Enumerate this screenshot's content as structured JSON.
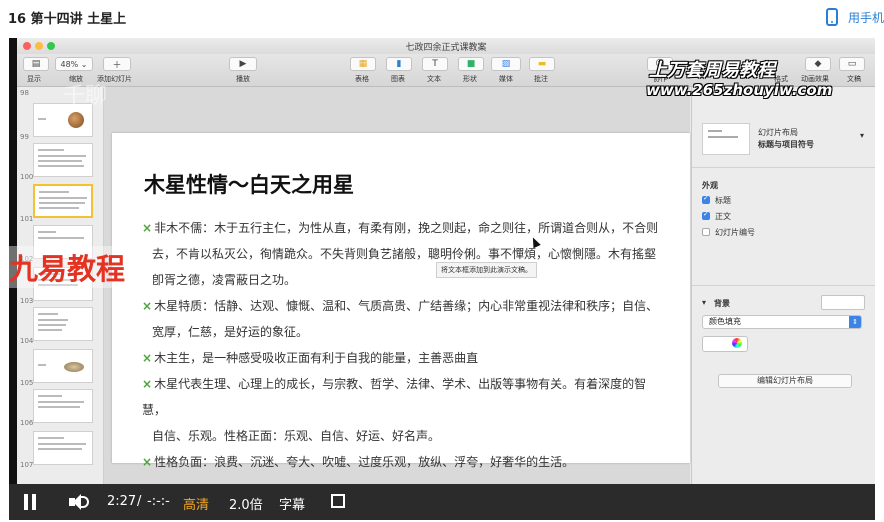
{
  "page": {
    "title": "16 第十四讲 土星上",
    "phone_label": "用手机"
  },
  "window": {
    "doc_title": "七政四余正式课教案"
  },
  "toolbar": {
    "view_label": "显示",
    "zoom_value": "48%",
    "zoom_label": "缩放",
    "add_slide_label": "添加幻灯片",
    "play_label": "播放",
    "table_label": "表格",
    "chart_label": "图表",
    "text_label": "文本",
    "shape_label": "形状",
    "media_label": "媒体",
    "comment_label": "批注",
    "collaborate_label": "协作",
    "format_label": "格式",
    "animate_label": "动画效果",
    "document_label": "文稿"
  },
  "navigator": {
    "slide_numbers": [
      "98",
      "99",
      "100",
      "101",
      "102",
      "103",
      "104",
      "105",
      "106",
      "107"
    ]
  },
  "slide": {
    "title": "木星性情～白天之用星",
    "bullets": [
      {
        "mark": "×",
        "lines": [
          "非木不儒：木于五行主仁，为性从直，有柔有刚，挽之则起，命之则往，所谓道合则从，不合则",
          "去，不肯以私灭公，徇情跪众。不失背则負艺諸般，聰明伶俐。事不憚煩，心懷惻隱。木有搖壑",
          "卽胥之德，凌霄蔽日之功。"
        ]
      },
      {
        "mark": "×",
        "lines": [
          "木星特质：恬静、达观、慷慨、温和、气质高贵、广结善缘；内心非常重视法律和秩序；自信、",
          "宽厚，仁慈，是好运的象征。"
        ]
      },
      {
        "mark": "×",
        "lines": [
          "木主生，是一种感受吸收正面有利于自我的能量，主善恶曲直"
        ]
      },
      {
        "mark": "×",
        "lines": [
          "木星代表生理、心理上的成长，与宗教、哲学、法律、学术、出版等事物有关。有着深度的智慧，",
          "自信、乐观。性格正面：乐观、自信、好运、好名声。"
        ]
      },
      {
        "mark": "×",
        "lines": [
          "性格负面：浪费、沉迷、夸大、吹嘘、过度乐观，放纵、浮夸，好奢华的生活。"
        ]
      }
    ],
    "tooltip": "将文本框添加到此演示文稿。"
  },
  "inspector": {
    "layout_title": "幻灯片布局",
    "layout_name": "标题与项目符号",
    "appearance_header": "外观",
    "title_check": "标题",
    "body_check": "正文",
    "slide_number_check": "幻灯片编号",
    "background_header": "背景",
    "fill_option": "颜色填充",
    "edit_layout_button": "编辑幻灯片布局"
  },
  "watermarks": {
    "site_name": "上万套周易教程",
    "site_url": "www.265zhouyiw.com",
    "brand": "九易教程",
    "qianliao": "千聊"
  },
  "player": {
    "time_current": "2:27",
    "time_sep": "/",
    "time_total": "-:-:-",
    "quality": "高清",
    "speed": "2.0倍",
    "subtitles": "字幕"
  },
  "colors": {
    "accent_blue": "#2a7fd4",
    "quality_orange": "#f5a623",
    "brand_red": "#e53323",
    "selection_yellow": "#f2c232"
  }
}
